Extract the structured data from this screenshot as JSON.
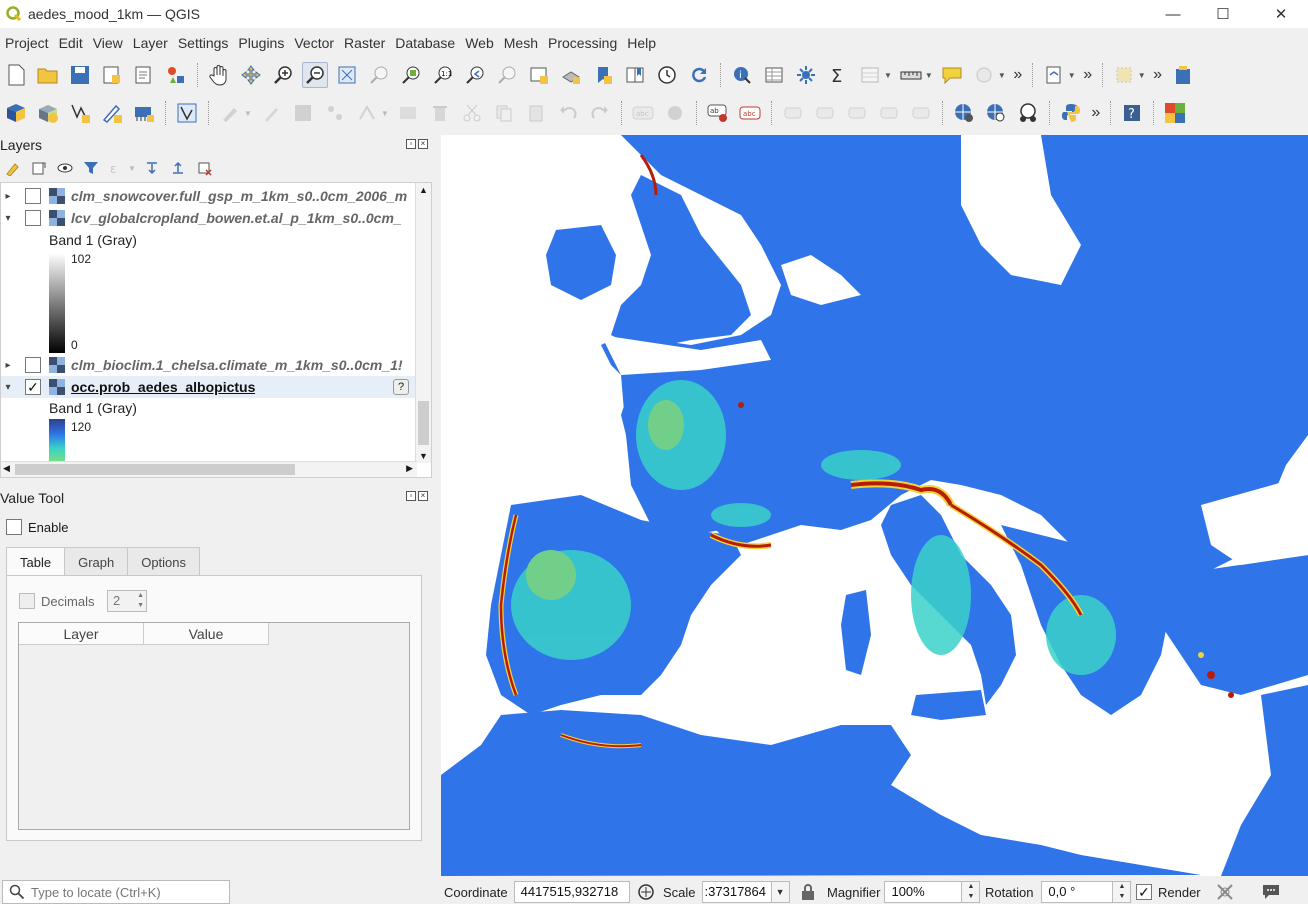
{
  "window": {
    "title": "aedes_mood_1km — QGIS",
    "minimize": "—",
    "maximize": "☐",
    "close": "✕"
  },
  "menu": [
    "Project",
    "Edit",
    "View",
    "Layer",
    "Settings",
    "Plugins",
    "Vector",
    "Raster",
    "Database",
    "Web",
    "Mesh",
    "Processing",
    "Help"
  ],
  "layers_panel": {
    "title": "Layers",
    "items": [
      {
        "name": "clm_snowcover.full_gsp_m_1km_s0..0cm_2006_m",
        "checked": false,
        "expanded": false
      },
      {
        "name": "lcv_globalcropland_bowen.et.al_p_1km_s0..0cm_",
        "checked": false,
        "expanded": true
      },
      {
        "name": "clm_bioclim.1_chelsa.climate_m_1km_s0..0cm_1!",
        "checked": false,
        "expanded": false
      },
      {
        "name": "occ.prob_aedes_albopictus",
        "checked": true,
        "expanded": true
      }
    ],
    "legend1": {
      "band": "Band 1 (Gray)",
      "max": "102",
      "min": "0"
    },
    "legend2": {
      "band": "Band 1 (Gray)",
      "max": "120"
    },
    "help_badge": "?"
  },
  "value_tool": {
    "title": "Value Tool",
    "enable": "Enable",
    "tabs": [
      "Table",
      "Graph",
      "Options"
    ],
    "decimals_label": "Decimals",
    "decimals_value": "2",
    "columns": [
      "Layer",
      "Value"
    ]
  },
  "statusbar": {
    "locate_placeholder": "Type to locate (Ctrl+K)",
    "coordinate_label": "Coordinate",
    "coordinate_value": "4417515,932718",
    "scale_label": "Scale",
    "scale_value": ":37317864",
    "magnifier_label": "Magnifier",
    "magnifier_value": "100%",
    "rotation_label": "Rotation",
    "rotation_value": "0,0 °",
    "render_label": "Render"
  },
  "colors": {
    "land": "#2f74e8",
    "sea": "#ffffff",
    "hot": "#b81c08",
    "mid": "#f2d23a",
    "low": "#39d1c9"
  }
}
